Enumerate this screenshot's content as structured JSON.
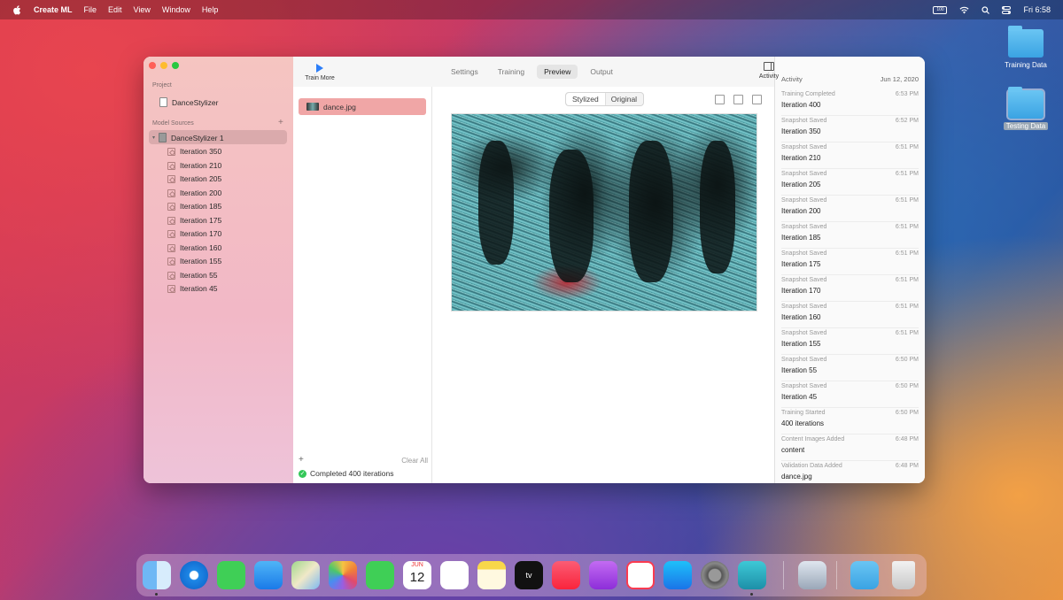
{
  "menubar": {
    "app_name": "Create ML",
    "menus": [
      "File",
      "Edit",
      "View",
      "Window",
      "Help"
    ],
    "clock": "Fri 6:58",
    "battery_label": "100"
  },
  "desktop": {
    "folders": [
      {
        "label": "Training Data"
      },
      {
        "label": "Testing Data"
      }
    ]
  },
  "sidebar": {
    "project_header": "Project",
    "project_name": "DanceStylizer",
    "model_sources_header": "Model Sources",
    "add_label": "+",
    "model_name": "DanceStylizer 1",
    "iterations": [
      "Iteration 350",
      "Iteration 210",
      "Iteration 205",
      "Iteration 200",
      "Iteration 185",
      "Iteration 175",
      "Iteration 170",
      "Iteration 160",
      "Iteration 155",
      "Iteration 55",
      "Iteration 45"
    ]
  },
  "toolbar": {
    "train_more_label": "Train More",
    "tabs": [
      "Settings",
      "Training",
      "Preview",
      "Output"
    ],
    "active_tab": "Preview",
    "activity_label": "Activity"
  },
  "filelist": {
    "selected_file": "dance.jpg",
    "add_label": "+",
    "clear_label": "Clear All",
    "status": "Completed 400 iterations"
  },
  "preview": {
    "segment_options": [
      "Stylized",
      "Original"
    ],
    "selected_segment": "Stylized"
  },
  "activity": {
    "header": "Activity",
    "date": "Jun 12, 2020",
    "entries": [
      {
        "title": "Training Completed",
        "time": "6:53 PM",
        "detail": "Iteration 400"
      },
      {
        "title": "Snapshot Saved",
        "time": "6:52 PM",
        "detail": "Iteration 350"
      },
      {
        "title": "Snapshot Saved",
        "time": "6:51 PM",
        "detail": "Iteration 210"
      },
      {
        "title": "Snapshot Saved",
        "time": "6:51 PM",
        "detail": "Iteration 205"
      },
      {
        "title": "Snapshot Saved",
        "time": "6:51 PM",
        "detail": "Iteration 200"
      },
      {
        "title": "Snapshot Saved",
        "time": "6:51 PM",
        "detail": "Iteration 185"
      },
      {
        "title": "Snapshot Saved",
        "time": "6:51 PM",
        "detail": "Iteration 175"
      },
      {
        "title": "Snapshot Saved",
        "time": "6:51 PM",
        "detail": "Iteration 170"
      },
      {
        "title": "Snapshot Saved",
        "time": "6:51 PM",
        "detail": "Iteration 160"
      },
      {
        "title": "Snapshot Saved",
        "time": "6:51 PM",
        "detail": "Iteration 155"
      },
      {
        "title": "Snapshot Saved",
        "time": "6:50 PM",
        "detail": "Iteration 55"
      },
      {
        "title": "Snapshot Saved",
        "time": "6:50 PM",
        "detail": "Iteration 45"
      },
      {
        "title": "Training Started",
        "time": "6:50 PM",
        "detail": "400 iterations"
      },
      {
        "title": "Content Images Added",
        "time": "6:48 PM",
        "detail": "content"
      },
      {
        "title": "Validation Data Added",
        "time": "6:48 PM",
        "detail": "dance.jpg"
      }
    ]
  },
  "dock": {
    "calendar_month": "JUN",
    "calendar_day": "12",
    "tv_label": "tv",
    "apps": [
      "finder-icon",
      "safari-icon",
      "messages-icon",
      "mail-icon",
      "maps-icon",
      "photos-icon",
      "facetime-icon",
      "calendar-icon",
      "reminders-icon",
      "notes-icon",
      "appletv-icon",
      "music-icon",
      "podcasts-icon",
      "news-icon",
      "appstore-icon",
      "system-preferences-icon",
      "createml-icon",
      "preview-icon",
      "downloads-folder-icon",
      "trash-icon"
    ]
  }
}
